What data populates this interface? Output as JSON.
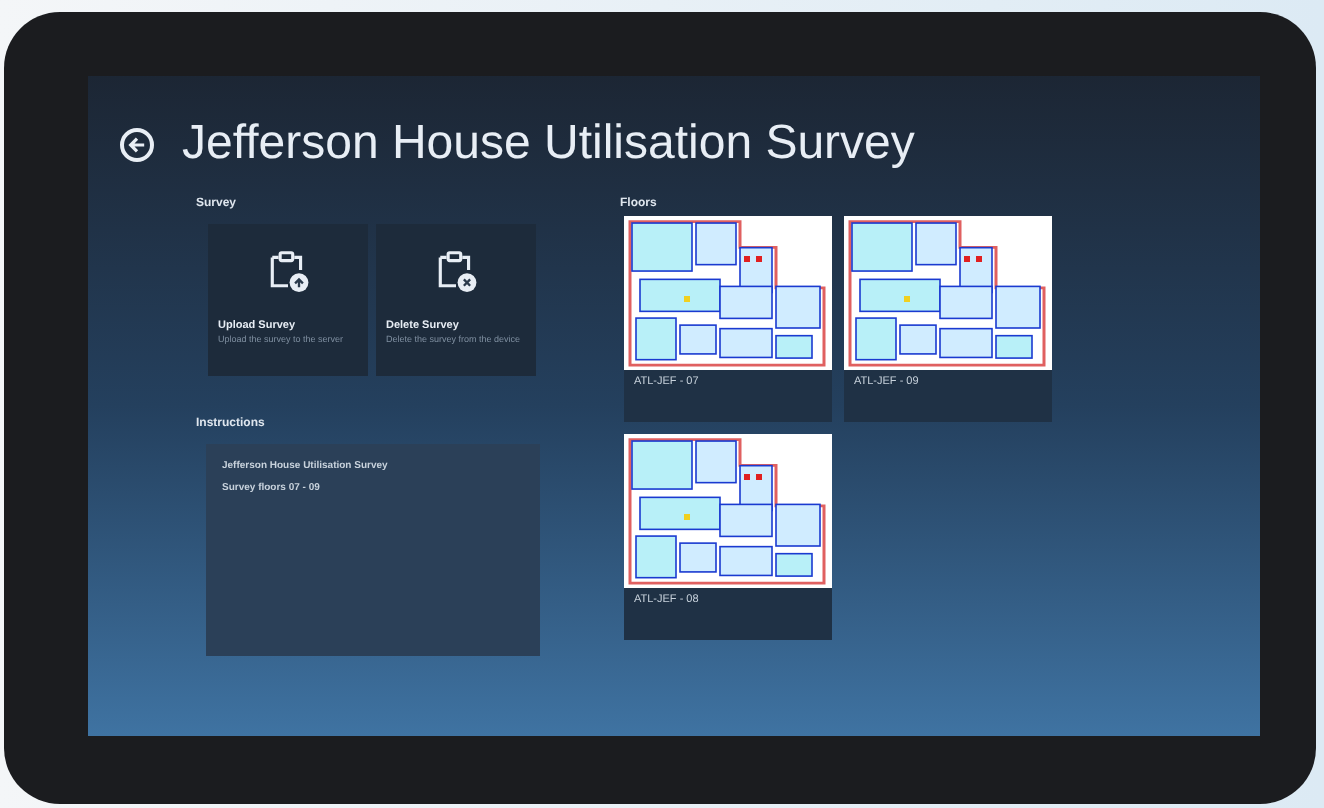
{
  "page": {
    "title": "Jefferson House Utilisation Survey"
  },
  "survey": {
    "heading": "Survey",
    "actions": [
      {
        "kind": "upload",
        "title": "Upload Survey",
        "description": "Upload the survey to the server"
      },
      {
        "kind": "delete",
        "title": "Delete Survey",
        "description": "Delete the survey from the device"
      }
    ]
  },
  "instructions": {
    "heading": "Instructions",
    "lines": [
      "Jefferson House Utilisation Survey",
      "Survey floors 07 - 09"
    ]
  },
  "floors": {
    "heading": "Floors",
    "items": [
      {
        "label": "ATL-JEF - 07"
      },
      {
        "label": "ATL-JEF - 09"
      },
      {
        "label": "ATL-JEF - 08"
      }
    ]
  }
}
